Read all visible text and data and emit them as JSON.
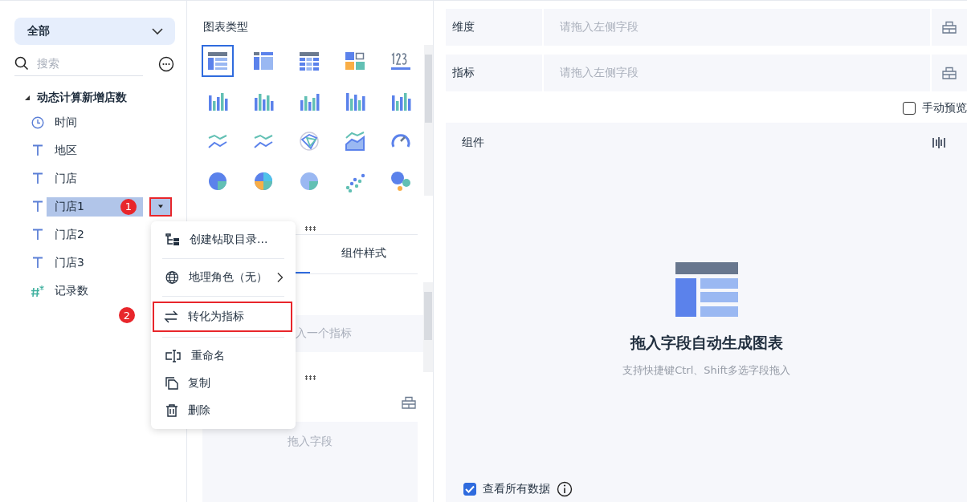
{
  "sidebar": {
    "scope_select": {
      "value": "全部"
    },
    "search": {
      "placeholder": "搜索"
    },
    "tree": [
      {
        "label": "动态计算新增店数",
        "expanded": true,
        "children": [
          {
            "label": "时间",
            "kind": "time",
            "selected": false
          },
          {
            "label": "地区",
            "kind": "text",
            "selected": false
          },
          {
            "label": "门店",
            "kind": "text",
            "selected": false
          },
          {
            "label": "门店1",
            "kind": "text",
            "selected": true,
            "step_badge": "1"
          },
          {
            "label": "门店2",
            "kind": "text",
            "selected": false
          },
          {
            "label": "门店3",
            "kind": "text",
            "selected": false
          },
          {
            "label": "记录数",
            "kind": "number",
            "selected": false
          }
        ]
      }
    ]
  },
  "context_menu": {
    "groups": [
      [
        {
          "label": "创建钻取目录...",
          "kind": "drill",
          "submenu": false,
          "highlighted": false
        }
      ],
      [
        {
          "label": "地理角色（无）",
          "kind": "globe",
          "submenu": true,
          "highlighted": false
        }
      ],
      [
        {
          "label": "转化为指标",
          "kind": "convert",
          "submenu": false,
          "highlighted": true,
          "step_badge": "2"
        }
      ],
      [
        {
          "label": "重命名",
          "kind": "rename",
          "submenu": false,
          "highlighted": false
        },
        {
          "label": "复制",
          "kind": "copy",
          "submenu": false,
          "highlighted": false
        },
        {
          "label": "删除",
          "kind": "delete",
          "submenu": false,
          "highlighted": false
        }
      ]
    ]
  },
  "chart_panel": {
    "title": "图表类型",
    "chart_types": [
      {
        "selected": true
      },
      {
        "selected": false
      },
      {
        "selected": false
      },
      {
        "selected": false
      },
      {
        "selected": false
      },
      {
        "selected": false
      },
      {
        "selected": false
      },
      {
        "selected": false
      },
      {
        "selected": false
      },
      {
        "selected": false
      },
      {
        "selected": false
      },
      {
        "selected": false
      },
      {
        "selected": false
      },
      {
        "selected": false
      },
      {
        "selected": false
      },
      {
        "selected": false
      },
      {
        "selected": false
      },
      {
        "selected": false
      },
      {
        "selected": false
      },
      {
        "selected": false
      }
    ],
    "tabs": [
      {
        "selected": true
      },
      {
        "label": "组件样式",
        "selected": false
      }
    ],
    "metric_drop": {
      "placeholder": "入一个指标"
    },
    "field_drop": {
      "placeholder": "拖入字段"
    }
  },
  "fields": [
    {
      "label": "维度",
      "placeholder": "请拖入左侧字段"
    },
    {
      "label": "指标",
      "placeholder": "请拖入左侧字段"
    }
  ],
  "manual_preview": {
    "label": "手动预览",
    "checked": false
  },
  "component": {
    "title": "组件",
    "empty_title": "拖入字段自动生成图表",
    "empty_hint": "支持快捷键Ctrl、Shift多选字段拖入",
    "view_all": {
      "label": "查看所有数据",
      "checked": true
    }
  }
}
